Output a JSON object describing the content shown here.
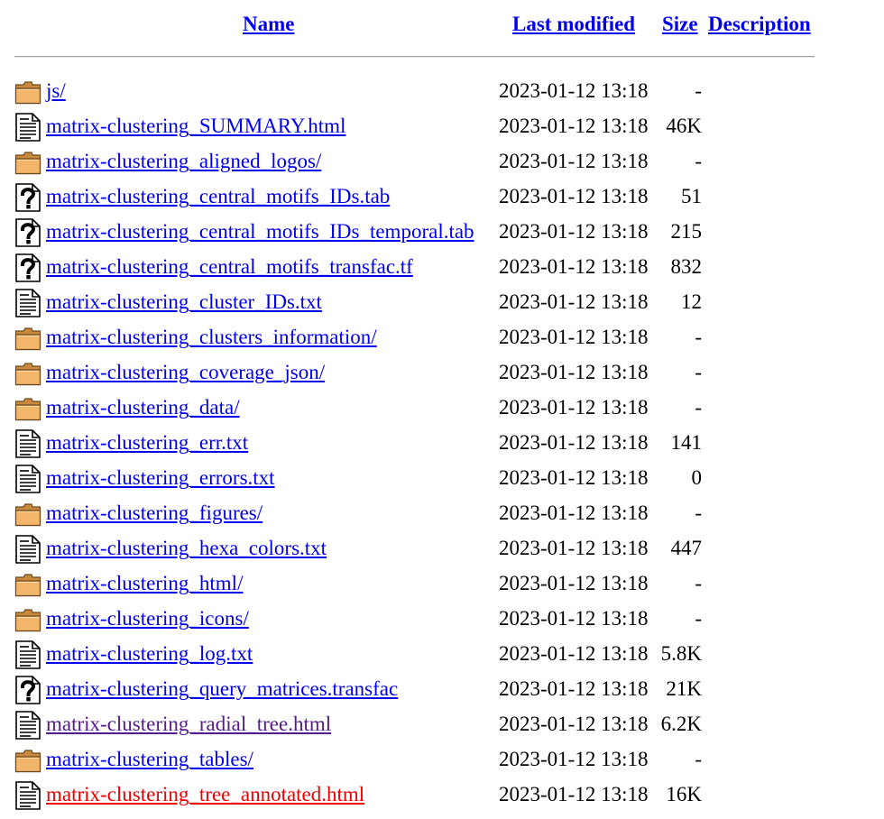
{
  "columns": {
    "name": "Name",
    "last_modified": "Last modified",
    "size": "Size",
    "description": "Description"
  },
  "entries": [
    {
      "icon": "folder-icon",
      "name": "js/",
      "modified": "2023-01-12 13:18",
      "size": "-",
      "description": "",
      "link_state": "unvisited"
    },
    {
      "icon": "text-file-icon",
      "name": "matrix-clustering_SUMMARY.html",
      "modified": "2023-01-12 13:18",
      "size": "46K",
      "description": "",
      "link_state": "unvisited"
    },
    {
      "icon": "folder-icon",
      "name": "matrix-clustering_aligned_logos/",
      "modified": "2023-01-12 13:18",
      "size": "-",
      "description": "",
      "link_state": "unvisited"
    },
    {
      "icon": "unknown-file-icon",
      "name": "matrix-clustering_central_motifs_IDs.tab",
      "modified": "2023-01-12 13:18",
      "size": "51",
      "description": "",
      "link_state": "unvisited"
    },
    {
      "icon": "unknown-file-icon",
      "name": "matrix-clustering_central_motifs_IDs_temporal.tab",
      "modified": "2023-01-12 13:18",
      "size": "215",
      "description": "",
      "link_state": "unvisited"
    },
    {
      "icon": "unknown-file-icon",
      "name": "matrix-clustering_central_motifs_transfac.tf",
      "modified": "2023-01-12 13:18",
      "size": "832",
      "description": "",
      "link_state": "unvisited"
    },
    {
      "icon": "text-file-icon",
      "name": "matrix-clustering_cluster_IDs.txt",
      "modified": "2023-01-12 13:18",
      "size": "12",
      "description": "",
      "link_state": "unvisited"
    },
    {
      "icon": "folder-icon",
      "name": "matrix-clustering_clusters_information/",
      "modified": "2023-01-12 13:18",
      "size": "-",
      "description": "",
      "link_state": "unvisited"
    },
    {
      "icon": "folder-icon",
      "name": "matrix-clustering_coverage_json/",
      "modified": "2023-01-12 13:18",
      "size": "-",
      "description": "",
      "link_state": "unvisited"
    },
    {
      "icon": "folder-icon",
      "name": "matrix-clustering_data/",
      "modified": "2023-01-12 13:18",
      "size": "-",
      "description": "",
      "link_state": "unvisited"
    },
    {
      "icon": "text-file-icon",
      "name": "matrix-clustering_err.txt",
      "modified": "2023-01-12 13:18",
      "size": "141",
      "description": "",
      "link_state": "unvisited"
    },
    {
      "icon": "text-file-icon",
      "name": "matrix-clustering_errors.txt",
      "modified": "2023-01-12 13:18",
      "size": "0",
      "description": "",
      "link_state": "unvisited"
    },
    {
      "icon": "folder-icon",
      "name": "matrix-clustering_figures/",
      "modified": "2023-01-12 13:18",
      "size": "-",
      "description": "",
      "link_state": "unvisited"
    },
    {
      "icon": "text-file-icon",
      "name": "matrix-clustering_hexa_colors.txt",
      "modified": "2023-01-12 13:18",
      "size": "447",
      "description": "",
      "link_state": "unvisited"
    },
    {
      "icon": "folder-icon",
      "name": "matrix-clustering_html/",
      "modified": "2023-01-12 13:18",
      "size": "-",
      "description": "",
      "link_state": "unvisited"
    },
    {
      "icon": "folder-icon",
      "name": "matrix-clustering_icons/",
      "modified": "2023-01-12 13:18",
      "size": "-",
      "description": "",
      "link_state": "unvisited"
    },
    {
      "icon": "text-file-icon",
      "name": "matrix-clustering_log.txt",
      "modified": "2023-01-12 13:18",
      "size": "5.8K",
      "description": "",
      "link_state": "unvisited"
    },
    {
      "icon": "unknown-file-icon",
      "name": "matrix-clustering_query_matrices.transfac",
      "modified": "2023-01-12 13:18",
      "size": "21K",
      "description": "",
      "link_state": "unvisited"
    },
    {
      "icon": "text-file-icon",
      "name": "matrix-clustering_radial_tree.html",
      "modified": "2023-01-12 13:18",
      "size": "6.2K",
      "description": "",
      "link_state": "visited"
    },
    {
      "icon": "folder-icon",
      "name": "matrix-clustering_tables/",
      "modified": "2023-01-12 13:18",
      "size": "-",
      "description": "",
      "link_state": "unvisited"
    },
    {
      "icon": "text-file-icon",
      "name": "matrix-clustering_tree_annotated.html",
      "modified": "2023-01-12 13:18",
      "size": "16K",
      "description": "",
      "link_state": "active"
    }
  ],
  "colors": {
    "link": "#0000ee",
    "visited_link": "#551a8b",
    "active_link": "#ee0000",
    "folder_fill": "#f2b56a",
    "folder_outline": "#6b4a1f"
  }
}
